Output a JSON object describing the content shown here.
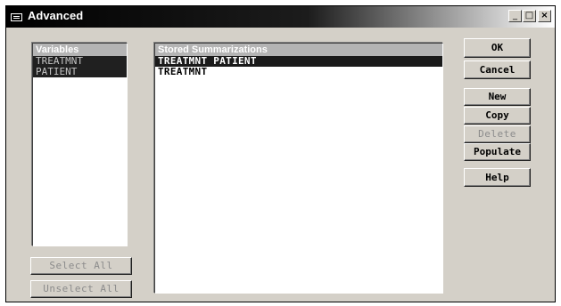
{
  "window": {
    "title": "Advanced",
    "controls": [
      "_",
      "□",
      "×"
    ]
  },
  "variables": {
    "header": "Variables",
    "items": [
      "TREATMNT",
      "PATIENT"
    ]
  },
  "summarizations": {
    "header": "Stored Summarizations",
    "items": [
      "TREATMNT PATIENT",
      "TREATMNT"
    ],
    "selected_index": 0
  },
  "buttons": {
    "ok": "OK",
    "cancel": "Cancel",
    "new": "New",
    "copy": "Copy",
    "delete": "Delete",
    "populate": "Populate",
    "help": "Help",
    "select_all": "Select All",
    "unselect_all": "Unselect All"
  }
}
